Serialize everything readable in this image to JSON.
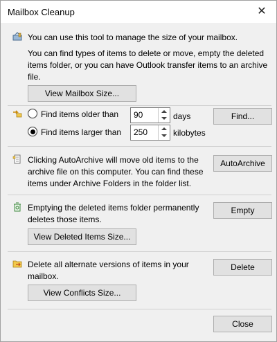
{
  "window": {
    "title": "Mailbox Cleanup",
    "close_glyph": "✕"
  },
  "mailbox": {
    "line1": "You can use this tool to manage the size of your mailbox.",
    "line2a": "You can find types of items to delete or move, empty the deleted",
    "line2b": "items folder, or you can have Outlook transfer items to an archive",
    "line2c": "file.",
    "view_size_button": "View Mailbox Size..."
  },
  "find": {
    "older_label": "Find items older than",
    "older_value": "90",
    "older_unit": "days",
    "older_selected": false,
    "larger_label": "Find items larger than",
    "larger_value": "250",
    "larger_unit": "kilobytes",
    "larger_selected": true,
    "find_button": "Find..."
  },
  "autoarchive": {
    "line1": "Clicking AutoArchive will move old items to the",
    "line2": "archive file on this computer. You can find these",
    "line3": "items under Archive Folders in the folder list.",
    "button": "AutoArchive"
  },
  "deleted": {
    "line1": "Emptying the deleted items folder permanently",
    "line2": "deletes those items.",
    "empty_button": "Empty",
    "view_button": "View Deleted Items Size..."
  },
  "conflicts": {
    "line1": "Delete all alternate versions of items in your",
    "line2": "mailbox.",
    "delete_button": "Delete",
    "view_button": "View Conflicts Size..."
  },
  "footer": {
    "close_button": "Close"
  },
  "icons": {
    "mailbox": "mailbox-tool-icon",
    "find": "find-items-icon",
    "archive": "archive-icon",
    "recycle": "recycle-bin-icon",
    "conflicts": "conflicts-folder-icon"
  }
}
